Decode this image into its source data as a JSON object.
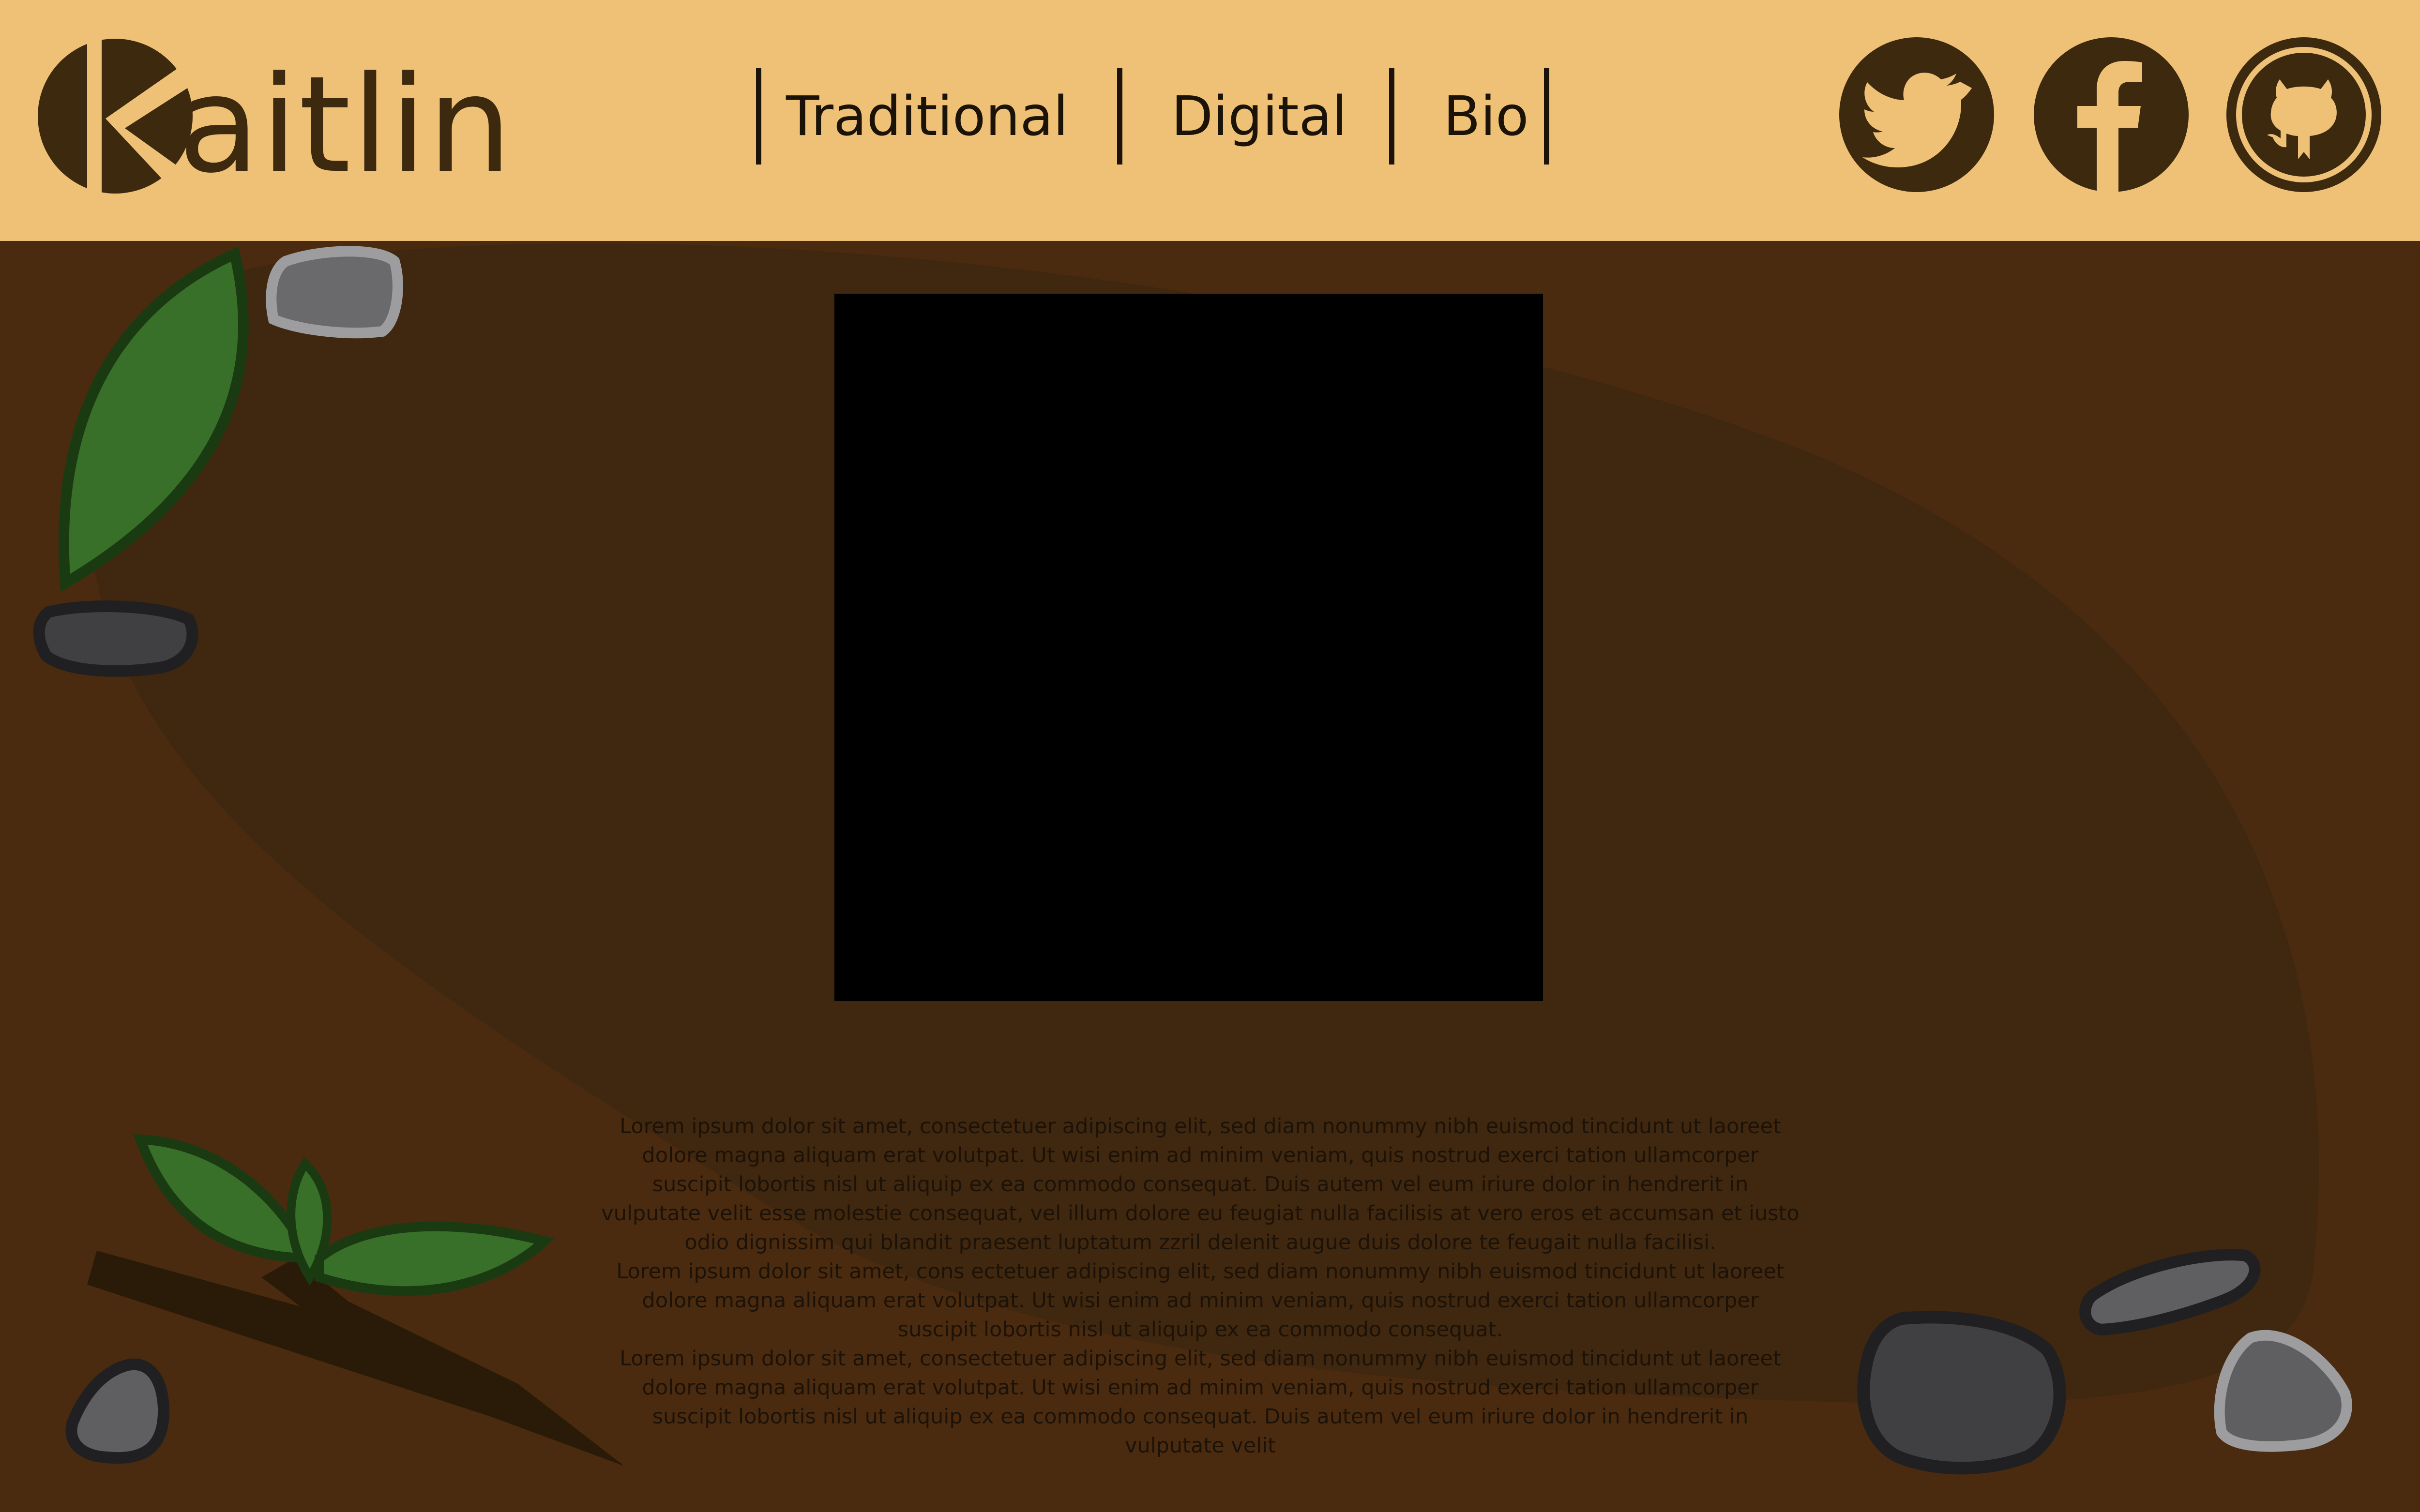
{
  "brand": {
    "name": "aitlin",
    "initial": "K",
    "colors": {
      "header": "#efc177",
      "ink": "#3d2a0e",
      "background": "#4a2b10",
      "blob": "#40270f"
    }
  },
  "nav": {
    "items": [
      {
        "label": "Traditional"
      },
      {
        "label": "Digital"
      },
      {
        "label": "Bio"
      }
    ]
  },
  "social": [
    {
      "icon": "twitter-icon"
    },
    {
      "icon": "facebook-icon"
    },
    {
      "icon": "github-icon"
    }
  ],
  "main": {
    "paragraphs": [
      "Lorem ipsum dolor sit amet, consectetuer adipiscing elit, sed diam nonummy nibh euismod tincidunt ut laoreet dolore magna aliquam erat volutpat. Ut wisi enim ad minim veniam, quis nostrud exerci tation ullamcorper suscipit lobortis nisl ut aliquip ex ea commodo consequat. Duis autem vel eum iriure dolor in hendrerit in vulputate velit esse molestie consequat, vel illum dolore eu feugiat nulla facilisis at vero eros et accumsan et iusto odio dignissim qui blandit praesent luptatum zzril delenit augue duis dolore te feugait nulla facilisi.",
      "Lorem ipsum dolor sit amet, cons ectetuer adipiscing elit, sed diam nonummy nibh euismod tincidunt ut laoreet dolore magna aliquam erat volutpat. Ut wisi enim ad minim veniam, quis nostrud exerci tation ullamcorper suscipit lobortis nisl ut aliquip ex ea commodo consequat.",
      "Lorem ipsum dolor sit amet, consectetuer adipiscing elit, sed diam nonummy nibh euismod tincidunt ut laoreet dolore magna aliquam erat volutpat. Ut wisi enim ad minim veniam, quis nostrud exerci tation ullamcorper suscipit lobortis nisl ut aliquip ex ea commodo consequat. Duis autem vel eum iriure dolor in hendrerit in vulputate velit"
    ]
  }
}
